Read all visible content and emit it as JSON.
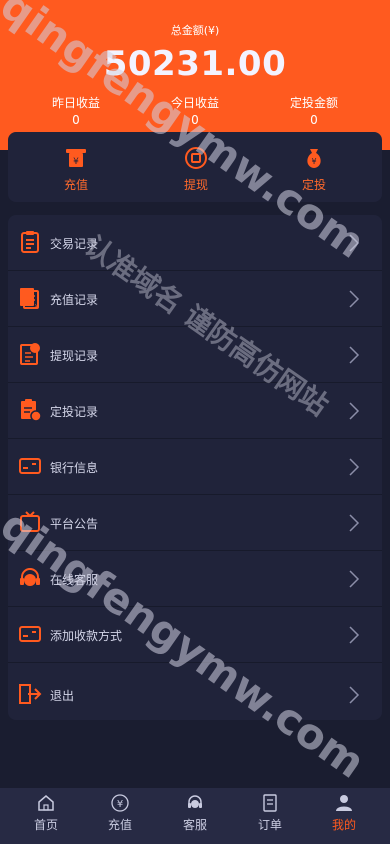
{
  "header": {
    "total_label": "总金额(¥)",
    "total_amount": "50231.00",
    "stats": [
      {
        "label": "昨日收益",
        "value": "0"
      },
      {
        "label": "今日收益",
        "value": "0"
      },
      {
        "label": "定投金额",
        "value": "0"
      }
    ]
  },
  "quick_actions": [
    {
      "label": "充值",
      "icon": "atm-yuan-icon"
    },
    {
      "label": "提现",
      "icon": "coin-icon"
    },
    {
      "label": "定投",
      "icon": "money-bag-icon"
    }
  ],
  "menu": [
    {
      "label": "交易记录",
      "icon": "clipboard-icon"
    },
    {
      "label": "充值记录",
      "icon": "recharge-record-icon"
    },
    {
      "label": "提现记录",
      "icon": "withdraw-record-icon"
    },
    {
      "label": "定投记录",
      "icon": "invest-record-icon"
    },
    {
      "label": "银行信息",
      "icon": "bank-card-icon"
    },
    {
      "label": "平台公告",
      "icon": "announcement-icon"
    },
    {
      "label": "在线客服",
      "icon": "headset-icon"
    },
    {
      "label": "添加收款方式",
      "icon": "add-card-icon"
    },
    {
      "label": "退出",
      "icon": "logout-icon"
    }
  ],
  "tabbar": [
    {
      "label": "首页",
      "icon": "home-icon"
    },
    {
      "label": "充值",
      "icon": "yuan-icon"
    },
    {
      "label": "客服",
      "icon": "headset-icon"
    },
    {
      "label": "订单",
      "icon": "order-icon"
    },
    {
      "label": "我的",
      "icon": "user-icon",
      "active": true
    }
  ],
  "watermarks": [
    "qingfengymw.com",
    "认准域名 谨防高仿网站",
    "qingfengymw.com"
  ],
  "colors": {
    "accent": "#ff5a1f",
    "background": "#1a1d30",
    "card": "#20233a",
    "tabbar": "#272a44"
  }
}
